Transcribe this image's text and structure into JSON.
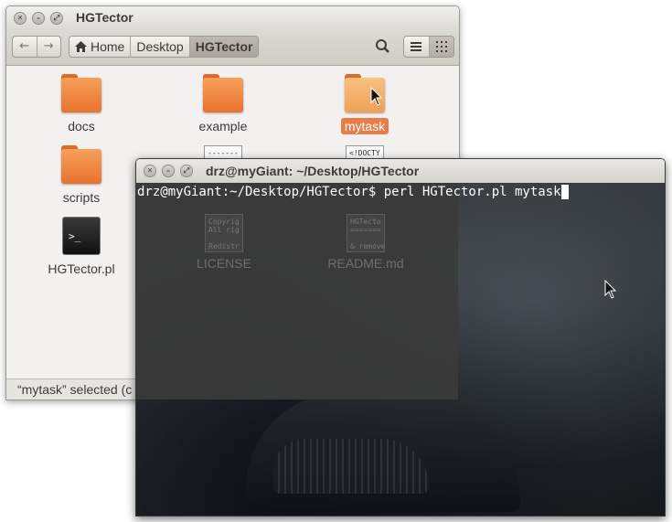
{
  "file_manager": {
    "title": "HGTector",
    "breadcrumbs": [
      "Home",
      "Desktop",
      "HGTector"
    ],
    "items": [
      {
        "name": "docs",
        "type": "folder"
      },
      {
        "name": "example",
        "type": "folder"
      },
      {
        "name": "mytask",
        "type": "folder",
        "selected": true
      },
      {
        "name": "scripts",
        "type": "folder"
      },
      {
        "name": "HGTector.pl",
        "type": "script",
        "icon_text": ">_"
      }
    ],
    "status": "“mytask” selected  (c"
  },
  "terminal": {
    "title": "drz@myGiant: ~/Desktop/HGTector",
    "prompt": "drz@myGiant:~/Desktop/HGTector$ perl HGTector.pl mytask",
    "ghost_items": [
      {
        "name": "LICENSE",
        "preview": "Copyrig\nAll rig\n\nRedistr"
      },
      {
        "name": "README.md",
        "preview": "HGTecto\n=======\n\n& remove"
      }
    ]
  },
  "peeking_doc_preview": "<!DOCTY\nhtml\n\n-------",
  "colors": {
    "folder": "#e8722e",
    "selection": "#e87d48",
    "terminal_bg": "#2e3236"
  }
}
